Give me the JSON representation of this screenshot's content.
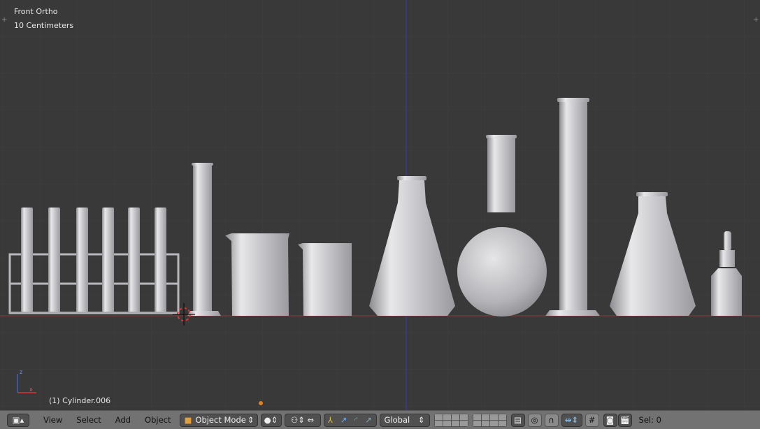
{
  "viewport": {
    "view_name": "Front Ortho",
    "scale_label": "10 Centimeters",
    "active_object": "(1) Cylinder.006",
    "background": "#393939",
    "ground_line_color": "#8a3a3a",
    "z_axis_line_color": "#3a3ab0",
    "axis_labels": {
      "z": "z",
      "x": "x"
    }
  },
  "toolbar": {
    "editor_type_icon": "cube-view-icon",
    "menus": [
      "View",
      "Select",
      "Add",
      "Object"
    ],
    "mode": "Object Mode",
    "shading": "solid-sphere-icon",
    "pivot_icon": "pivot-icon",
    "manipulator_icons": [
      "manipulator-toggle-icon",
      "translate-icon",
      "rotate-icon",
      "scale-icon"
    ],
    "orientation": "Global",
    "snap_icons": [
      "proportional-edit-icon",
      "snap-magnet-icon",
      "snap-element-icon",
      "snap-target-icon"
    ],
    "render_icons": [
      "opengl-render-icon",
      "opengl-animation-icon"
    ],
    "selection_count": "Sel: 0"
  }
}
